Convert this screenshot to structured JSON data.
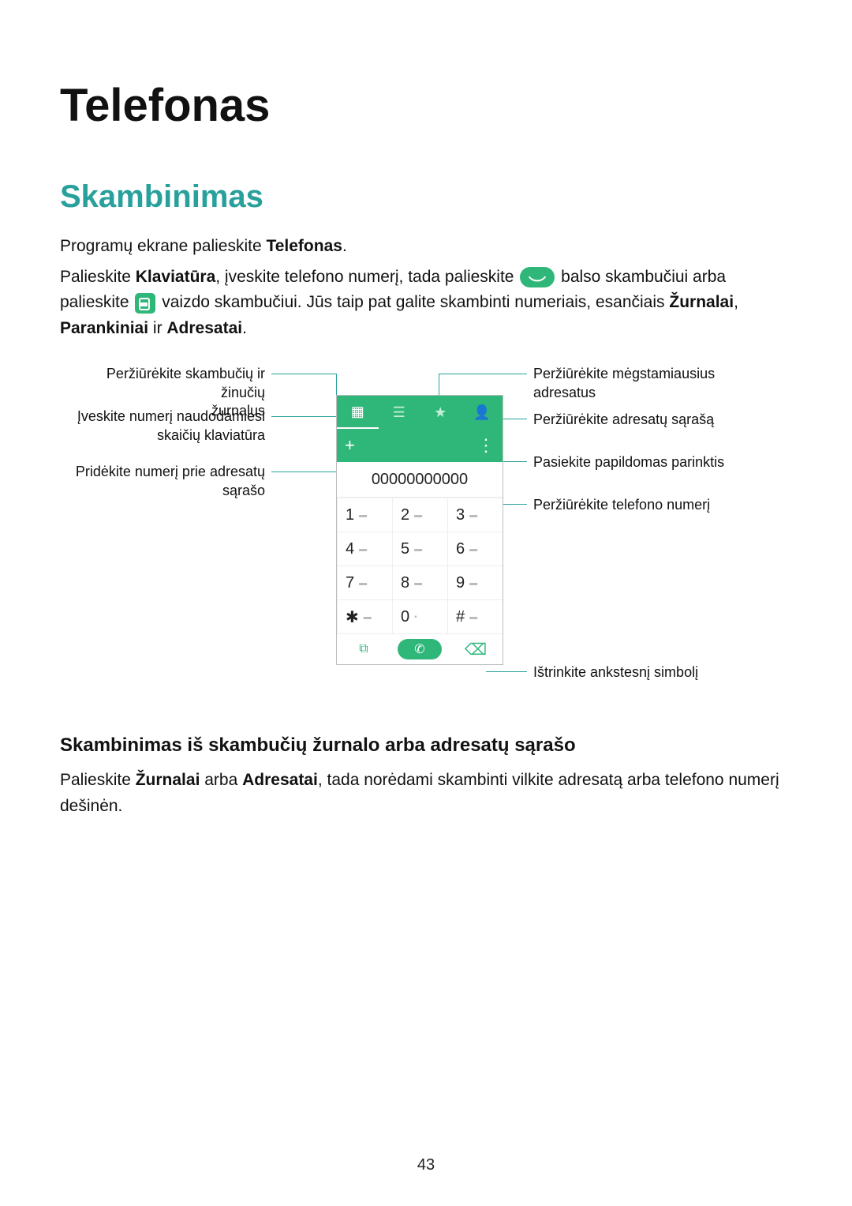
{
  "title": "Telefonas",
  "section": "Skambinimas",
  "p1_pre": "Programų ekrane palieskite ",
  "p1_bold": "Telefonas",
  "p1_post": ".",
  "p2_a": "Palieskite ",
  "p2_b": "Klaviatūra",
  "p2_c": ", įveskite telefono numerį, tada palieskite ",
  "p2_d": " balso skambučiui arba palieskite ",
  "p2_e": " vaizdo skambučiui. Jūs taip pat galite skambinti numeriais, esančiais ",
  "p2_f": "Žurnalai",
  "p2_g": ", ",
  "p2_h": "Parankiniai",
  "p2_i": " ir ",
  "p2_j": "Adresatai",
  "p2_k": ".",
  "callouts": {
    "left1": "Peržiūrėkite skambučių ir žinučių\nžurnalus",
    "left2": "Įveskite numerį naudodamiesi\nskaičių klaviatūra",
    "left3": "Pridėkite numerį prie adresatų\nsąrašo",
    "right1": "Peržiūrėkite mėgstamiausius\nadresatus",
    "right2": "Peržiūrėkite adresatų sąrašą",
    "right3": "Pasiekite papildomas parinktis",
    "right4": "Peržiūrėkite telefono numerį",
    "right5": "Ištrinkite ankstesnį simbolį"
  },
  "phone": {
    "number": "00000000000",
    "tabs": [
      "▦",
      "☰",
      "★",
      "👤"
    ],
    "add": "+",
    "more": "⋮",
    "keys": [
      "1",
      "2",
      "3",
      "4",
      "5",
      "6",
      "7",
      "8",
      "9",
      "✱",
      "0",
      "#"
    ]
  },
  "subhead": "Skambinimas iš skambučių žurnalo arba adresatų sąrašo",
  "p3_a": "Palieskite ",
  "p3_b": "Žurnalai",
  "p3_c": " arba ",
  "p3_d": "Adresatai",
  "p3_e": ", tada norėdami skambinti vilkite adresatą arba telefono numerį dešinėn.",
  "page_number": "43"
}
